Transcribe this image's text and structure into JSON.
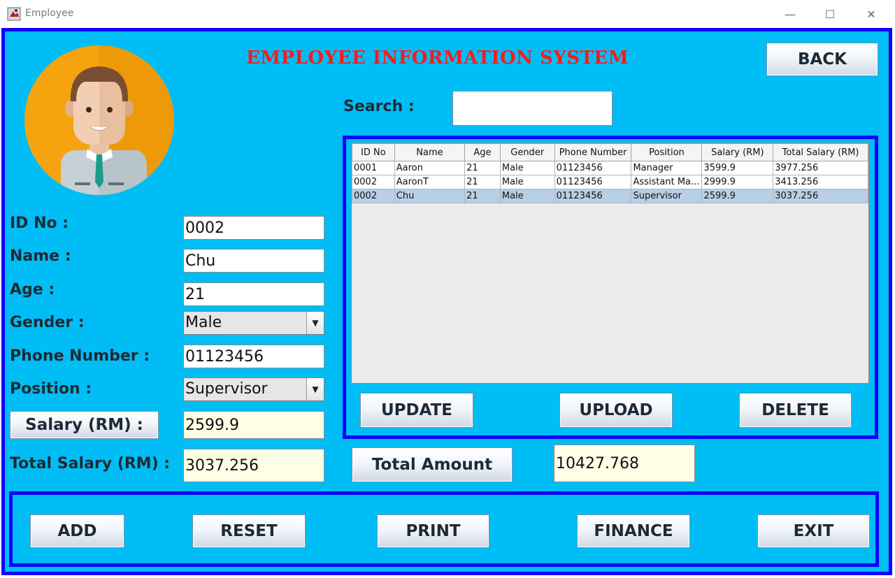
{
  "window": {
    "title": "Employee",
    "controls": {
      "minimize": "—",
      "maximize": "☐",
      "close": "✕"
    }
  },
  "header": {
    "title": "EMPLOYEE INFORMATION SYSTEM",
    "back_label": "BACK"
  },
  "search": {
    "label": "Search :",
    "value": ""
  },
  "form": {
    "id_label": "ID No :",
    "id_value": "0002",
    "name_label": "Name :",
    "name_value": "Chu",
    "age_label": "Age :",
    "age_value": "21",
    "gender_label": "Gender :",
    "gender_value": "Male",
    "phone_label": "Phone Number :",
    "phone_value": "01123456",
    "position_label": "Position :",
    "position_value": "Supervisor",
    "salary_button": "Salary (RM) :",
    "salary_value": "2599.9",
    "total_salary_label": "Total Salary (RM) :",
    "total_salary_value": "3037.256"
  },
  "table": {
    "columns": [
      "ID No",
      "Name",
      "Age",
      "Gender",
      "Phone Number",
      "Position",
      "Salary (RM)",
      "Total Salary (RM)"
    ],
    "rows": [
      [
        "0001",
        "Aaron",
        "21",
        "Male",
        "01123456",
        "Manager",
        "3599.9",
        "3977.256"
      ],
      [
        "0002",
        "AaronT",
        "21",
        "Male",
        "01123456",
        "Assistant Ma...",
        "2999.9",
        "3413.256"
      ],
      [
        "0002",
        "Chu",
        "21",
        "Male",
        "01123456",
        "Supervisor",
        "2599.9",
        "3037.256"
      ]
    ],
    "selected_row": 2
  },
  "table_actions": {
    "update": "UPDATE",
    "upload": "UPLOAD",
    "delete": "DELETE"
  },
  "totals": {
    "button": "Total Amount",
    "value": "10427.768"
  },
  "footer": {
    "add": "ADD",
    "reset": "RESET",
    "print": "PRINT",
    "finance": "FINANCE",
    "exit": "EXIT"
  },
  "colors": {
    "panel": "#00bdf5",
    "frame": "#1100ff",
    "heading": "#ff1a1a",
    "readonly_field": "#ffffe6",
    "selected_row": "#b8cfe5"
  },
  "icons": [
    "app-icon",
    "avatar",
    "chevron-down-icon"
  ]
}
